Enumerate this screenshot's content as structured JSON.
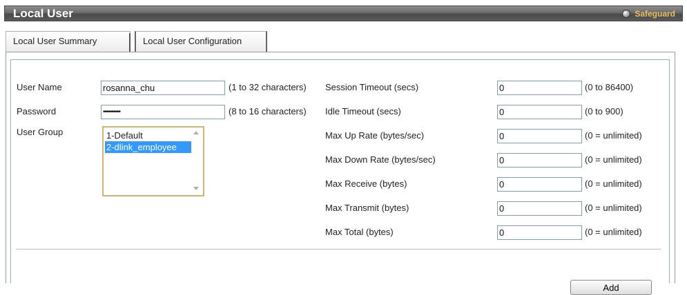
{
  "header": {
    "title": "Local User",
    "safeguard_label": "Safeguard"
  },
  "tabs": [
    {
      "label": "Local User Summary"
    },
    {
      "label": "Local User Configuration"
    }
  ],
  "form": {
    "user_name": {
      "label": "User Name",
      "value": "rosanna_chu",
      "hint": "(1 to 32 characters)"
    },
    "password": {
      "label": "Password",
      "value": "••••••••••",
      "hint": "(8 to 16 characters)"
    },
    "user_group": {
      "label": "User Group",
      "options": [
        "1-Default",
        "2-dlink_employee"
      ],
      "selected": "2-dlink_employee"
    },
    "session_timeout": {
      "label": "Session Timeout (secs)",
      "value": "0",
      "hint": "(0 to 86400)"
    },
    "idle_timeout": {
      "label": "Idle Timeout (secs)",
      "value": "0",
      "hint": "(0 to 900)"
    },
    "max_up_rate": {
      "label": "Max Up Rate (bytes/sec)",
      "value": "0",
      "hint": "(0 = unlimited)"
    },
    "max_down_rate": {
      "label": "Max Down Rate (bytes/sec)",
      "value": "0",
      "hint": "(0 = unlimited)"
    },
    "max_receive": {
      "label": "Max Receive (bytes)",
      "value": "0",
      "hint": "(0 = unlimited)"
    },
    "max_transmit": {
      "label": "Max Transmit (bytes)",
      "value": "0",
      "hint": "(0 = unlimited)"
    },
    "max_total": {
      "label": "Max Total (bytes)",
      "value": "0",
      "hint": "(0 = unlimited)"
    }
  },
  "actions": {
    "add_label": "Add"
  },
  "colors": {
    "selection": "#3399ff",
    "focus_border": "#d8b26a",
    "title_text": "#ffffff",
    "safeguard_text": "#e8c060"
  }
}
